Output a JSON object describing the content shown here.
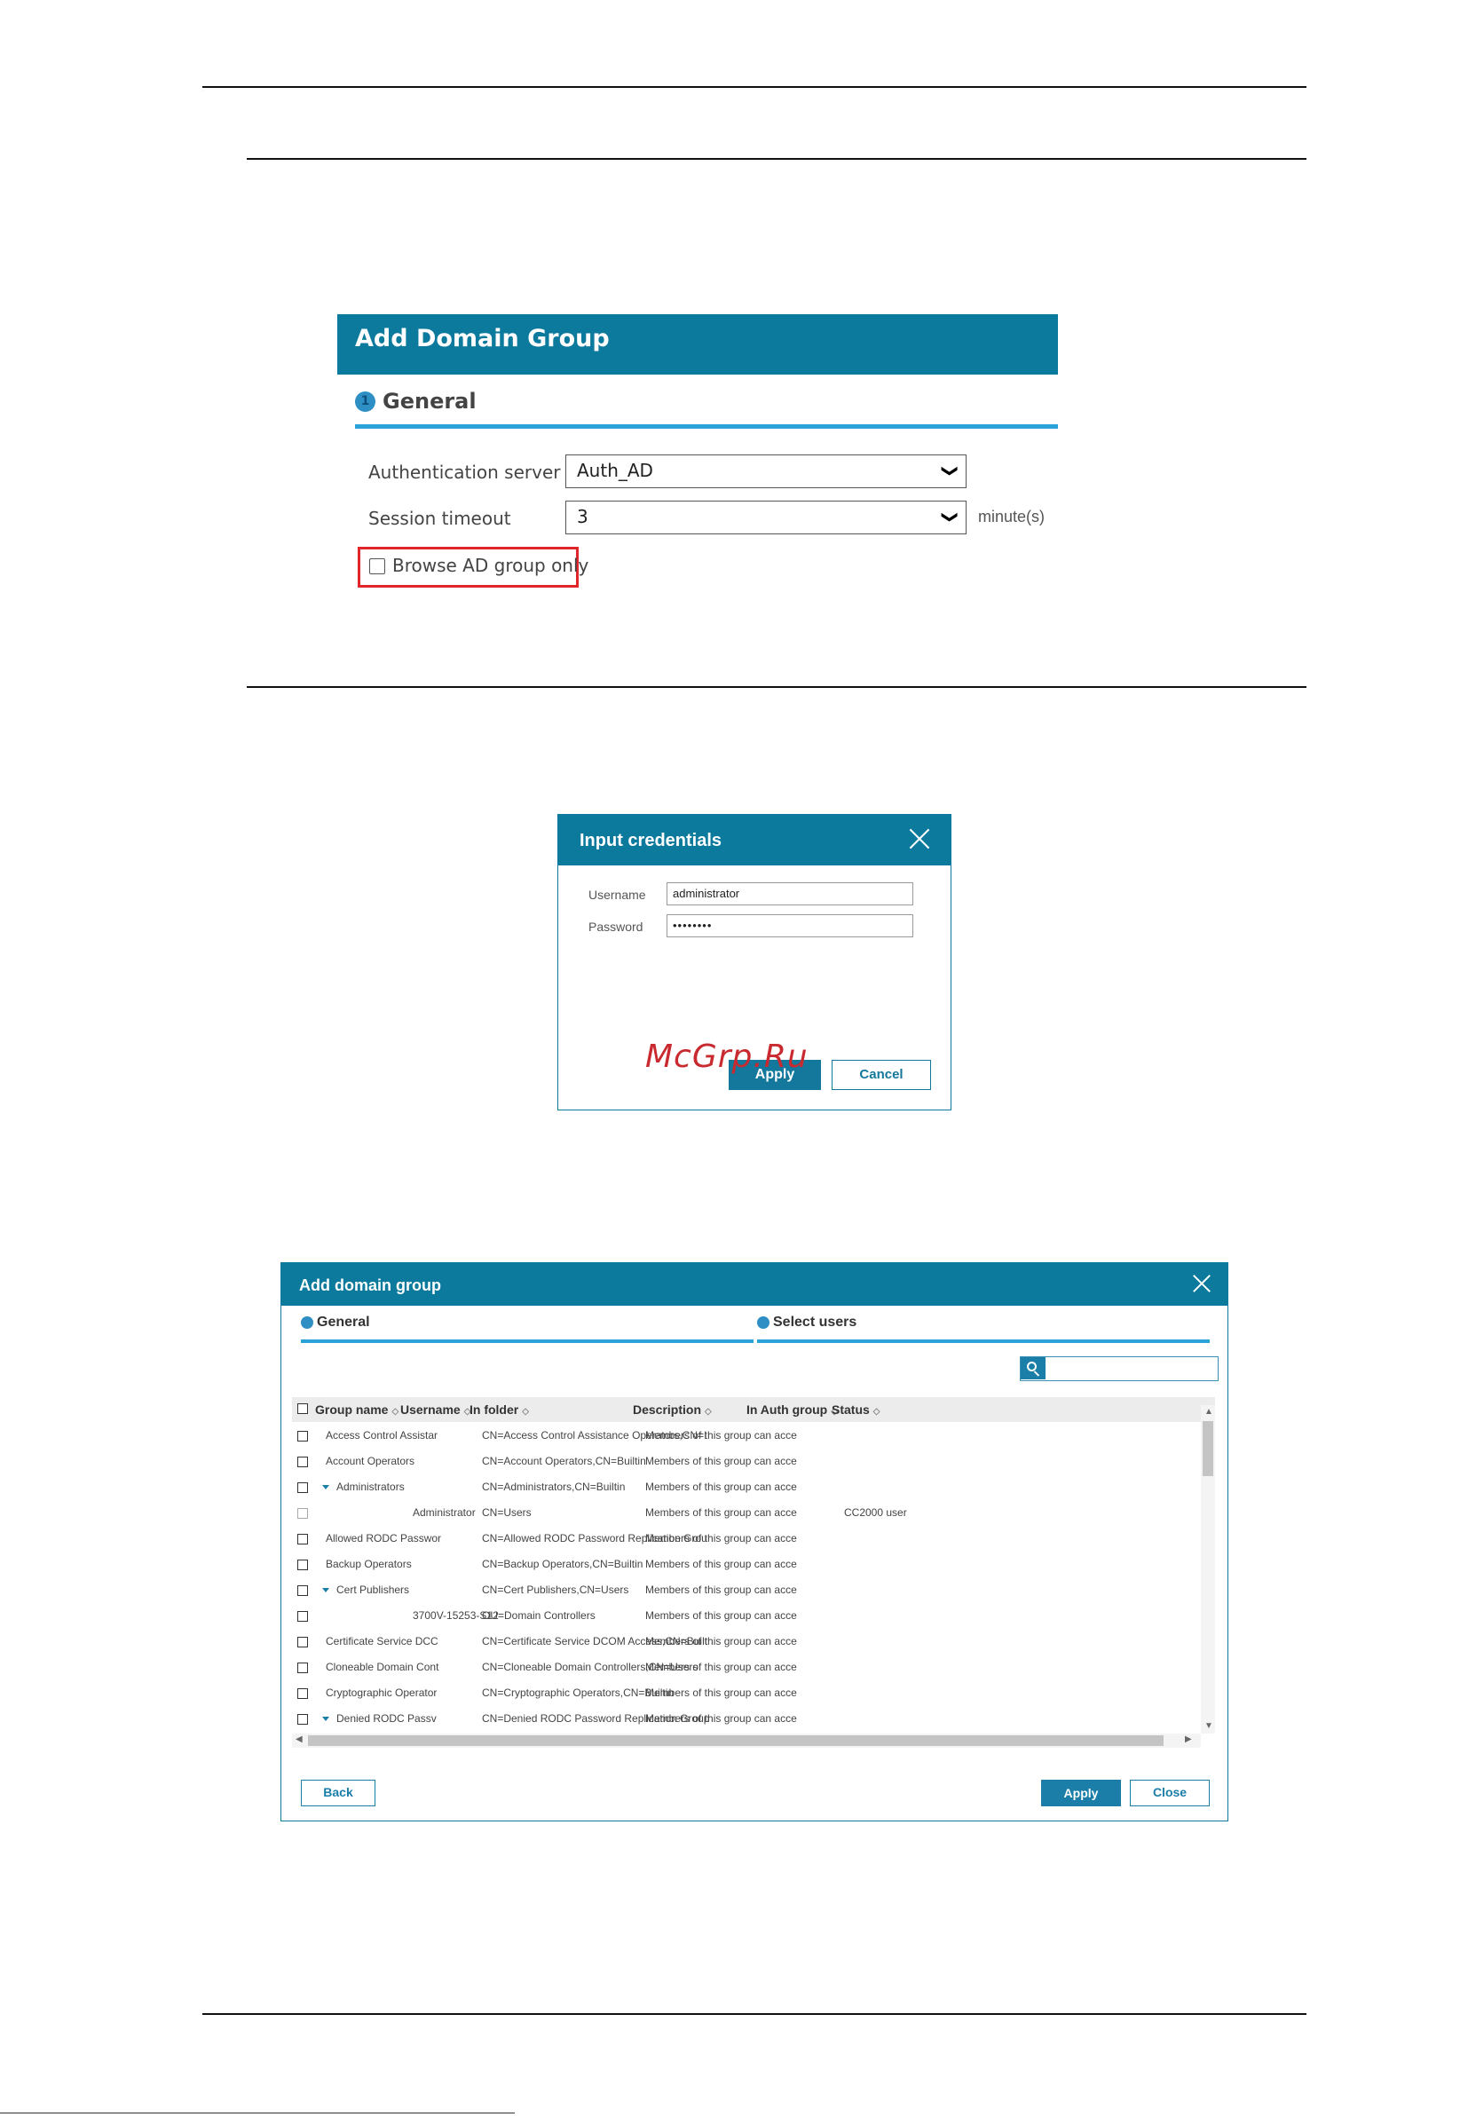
{
  "panel1": {
    "title": "Add Domain Group",
    "step_number": "1",
    "step_label": "General",
    "auth_server_label": "Authentication server",
    "auth_server_value": "Auth_AD",
    "session_timeout_label": "Session timeout",
    "session_timeout_value": "3",
    "session_timeout_unit": "minute(s)",
    "browse_ad_label": "Browse AD group only",
    "browse_ad_checked": false
  },
  "panel2": {
    "title": "Input credentials",
    "username_label": "Username",
    "username_value": "administrator",
    "password_label": "Password",
    "password_value": "••••••••",
    "apply_label": "Apply",
    "cancel_label": "Cancel",
    "watermark": "McGrp.Ru"
  },
  "panel3": {
    "title": "Add domain group",
    "steps": [
      "General",
      "Select users"
    ],
    "search_value": "",
    "columns": [
      "Group name",
      "Username",
      "In folder",
      "Description",
      "In Auth group",
      "Status"
    ],
    "rows": [
      {
        "group": "Access Control Assistar",
        "user": "",
        "folder": "CN=Access Control Assistance Operators,CN=I",
        "desc": "Members of this group can acce",
        "auth": "",
        "status": "",
        "expand": false,
        "dim": false
      },
      {
        "group": "Account Operators",
        "user": "",
        "folder": "CN=Account Operators,CN=Builtin",
        "desc": "Members of this group can acce",
        "auth": "",
        "status": "",
        "expand": false,
        "dim": false
      },
      {
        "group": "Administrators",
        "user": "",
        "folder": "CN=Administrators,CN=Builtin",
        "desc": "Members of this group can acce",
        "auth": "",
        "status": "",
        "expand": true,
        "dim": false
      },
      {
        "group": "",
        "user": "Administrator",
        "folder": "CN=Users",
        "desc": "Members of this group can acce",
        "auth": "",
        "status": "CC2000 user",
        "expand": false,
        "dim": true
      },
      {
        "group": "Allowed RODC Passwor",
        "user": "",
        "folder": "CN=Allowed RODC Password Replication Grou",
        "desc": "Members of this group can acce",
        "auth": "",
        "status": "",
        "expand": false,
        "dim": false
      },
      {
        "group": "Backup Operators",
        "user": "",
        "folder": "CN=Backup Operators,CN=Builtin",
        "desc": "Members of this group can acce",
        "auth": "",
        "status": "",
        "expand": false,
        "dim": false
      },
      {
        "group": "Cert Publishers",
        "user": "",
        "folder": "CN=Cert Publishers,CN=Users",
        "desc": "Members of this group can acce",
        "auth": "",
        "status": "",
        "expand": true,
        "dim": false
      },
      {
        "group": "",
        "user": "3700V-15253-S12",
        "folder": "OU=Domain Controllers",
        "desc": "Members of this group can acce",
        "auth": "",
        "status": "",
        "expand": false,
        "dim": false
      },
      {
        "group": "Certificate Service DCC",
        "user": "",
        "folder": "CN=Certificate Service DCOM Access,CN=Built",
        "desc": "Members of this group can acce",
        "auth": "",
        "status": "",
        "expand": false,
        "dim": false
      },
      {
        "group": "Cloneable Domain Cont",
        "user": "",
        "folder": "CN=Cloneable Domain Controllers,CN=Users",
        "desc": "Members of this group can acce",
        "auth": "",
        "status": "",
        "expand": false,
        "dim": false
      },
      {
        "group": "Cryptographic Operator",
        "user": "",
        "folder": "CN=Cryptographic Operators,CN=Builtin",
        "desc": "Members of this group can acce",
        "auth": "",
        "status": "",
        "expand": false,
        "dim": false
      },
      {
        "group": "Denied RODC Passv",
        "user": "",
        "folder": "CN=Denied RODC Password Replication Group",
        "desc": "Members of this group can acce",
        "auth": "",
        "status": "",
        "expand": true,
        "dim": false
      }
    ],
    "back_label": "Back",
    "apply_label": "Apply",
    "close_label": "Close"
  },
  "colors": {
    "header": "#0b7a9c",
    "accent_bar": "#2aa4d8",
    "highlight": "#e0262b",
    "button": "#1a7ea8"
  }
}
